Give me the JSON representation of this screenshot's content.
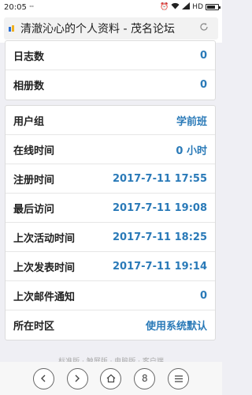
{
  "status_bar": {
    "time": "20:05",
    "dots": "···",
    "network": "HD"
  },
  "browser": {
    "title": "清澈沁心的个人资料 - 茂名论坛",
    "tab_count": "8"
  },
  "card1": {
    "rows": [
      {
        "label": "日志数",
        "value": "0"
      },
      {
        "label": "相册数",
        "value": "0"
      }
    ]
  },
  "card2": {
    "rows": [
      {
        "label": "用户组",
        "value": "学前班"
      },
      {
        "label": "在线时间",
        "value": "0 小时"
      },
      {
        "label": "注册时间",
        "value": "2017-7-11 17:55"
      },
      {
        "label": "最后访问",
        "value": "2017-7-11 19:08"
      },
      {
        "label": "上次活动时间",
        "value": "2017-7-11 18:25"
      },
      {
        "label": "上次发表时间",
        "value": "2017-7-11 19:14"
      },
      {
        "label": "上次邮件通知",
        "value": "0"
      },
      {
        "label": "所在时区",
        "value": "使用系统默认"
      }
    ]
  },
  "footer": {
    "links_text": "标准版 · 触屏版 · 电脑版 · 客户端"
  },
  "colors": {
    "value_blue": "#2a7ab8",
    "background": "#efeff4"
  }
}
